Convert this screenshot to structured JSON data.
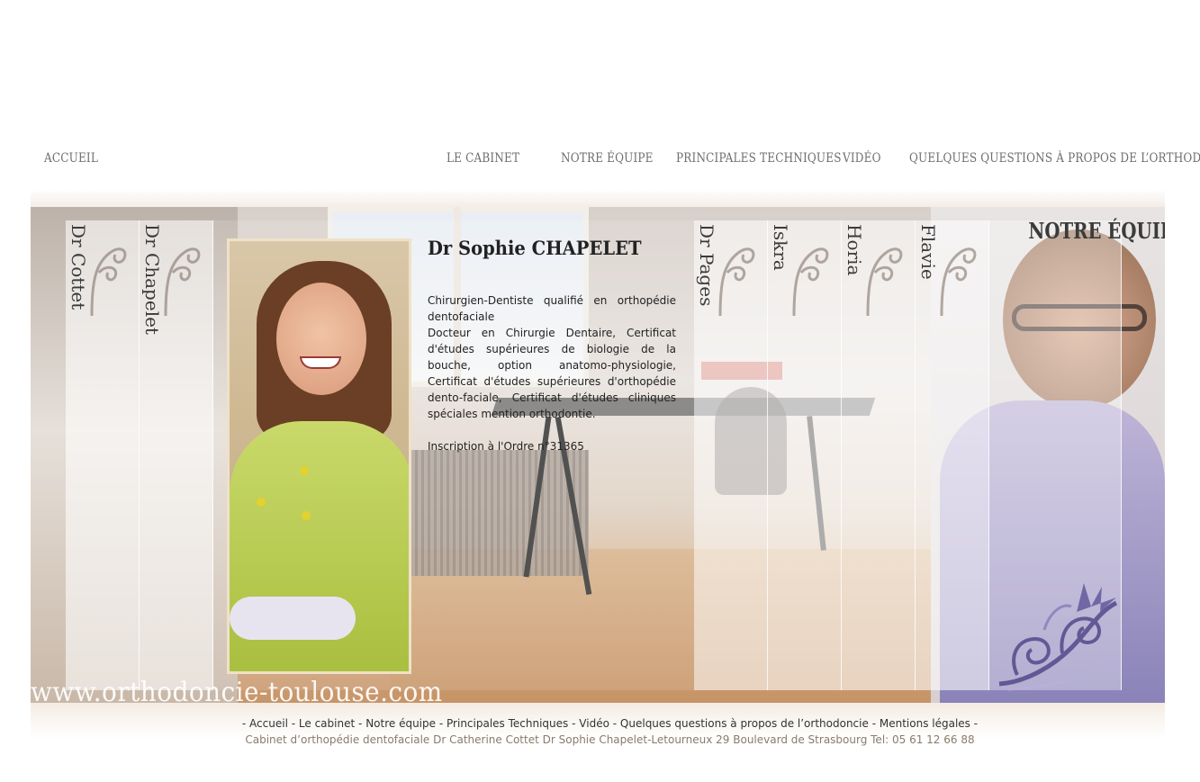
{
  "nav": {
    "accueil": "ACCUEIL",
    "cabinet": "LE CABINET",
    "equipe": "NOTRE ÉQUIPE",
    "techniques": "PRINCIPALES TECHNIQUES",
    "video": "VIDÉO",
    "questions": "QUELQUES QUESTIONS À PROPOS DE L’ORTHODONTIE"
  },
  "hero": {
    "section_title": "NOTRE ÉQUIPE",
    "panels": [
      "Dr Cottet",
      "Dr Chapelet",
      "Dr Pages",
      "Iskra",
      "Horia",
      "Flavie"
    ],
    "profile": {
      "name": "Dr Sophie CHAPELET",
      "para1": "Chirurgien-Dentiste qualifié en orthopédie dentofaciale",
      "para2": "Docteur en Chirurgie Dentaire, Certificat d'études supérieures de biologie de la bouche, option anatomo-physiologie, Certificat d'études supérieures d'orthopédie dento-faciale, Certificat d'études cliniques spéciales mention orthodontie.",
      "para3": "Inscription à l'Ordre n°31365"
    },
    "url": "www.orthodoncie-toulouse.com"
  },
  "footer": {
    "links": [
      "Accueil",
      "Le cabinet",
      "Notre équipe",
      "Principales Techniques",
      "Vidéo",
      "Quelques questions à propos de l’orthodoncie",
      "Mentions légales"
    ],
    "separator": "-",
    "address": "Cabinet d’orthopédie dentofaciale Dr Catherine Cottet Dr Sophie Chapelet-Letourneux 29 Boulevard de Strasbourg Tel: 05 61 12 66 88"
  },
  "colors": {
    "nav_text": "#6e6e6e",
    "ornament_purple": "#5a4f8f",
    "address_text": "#8a7a6a"
  }
}
